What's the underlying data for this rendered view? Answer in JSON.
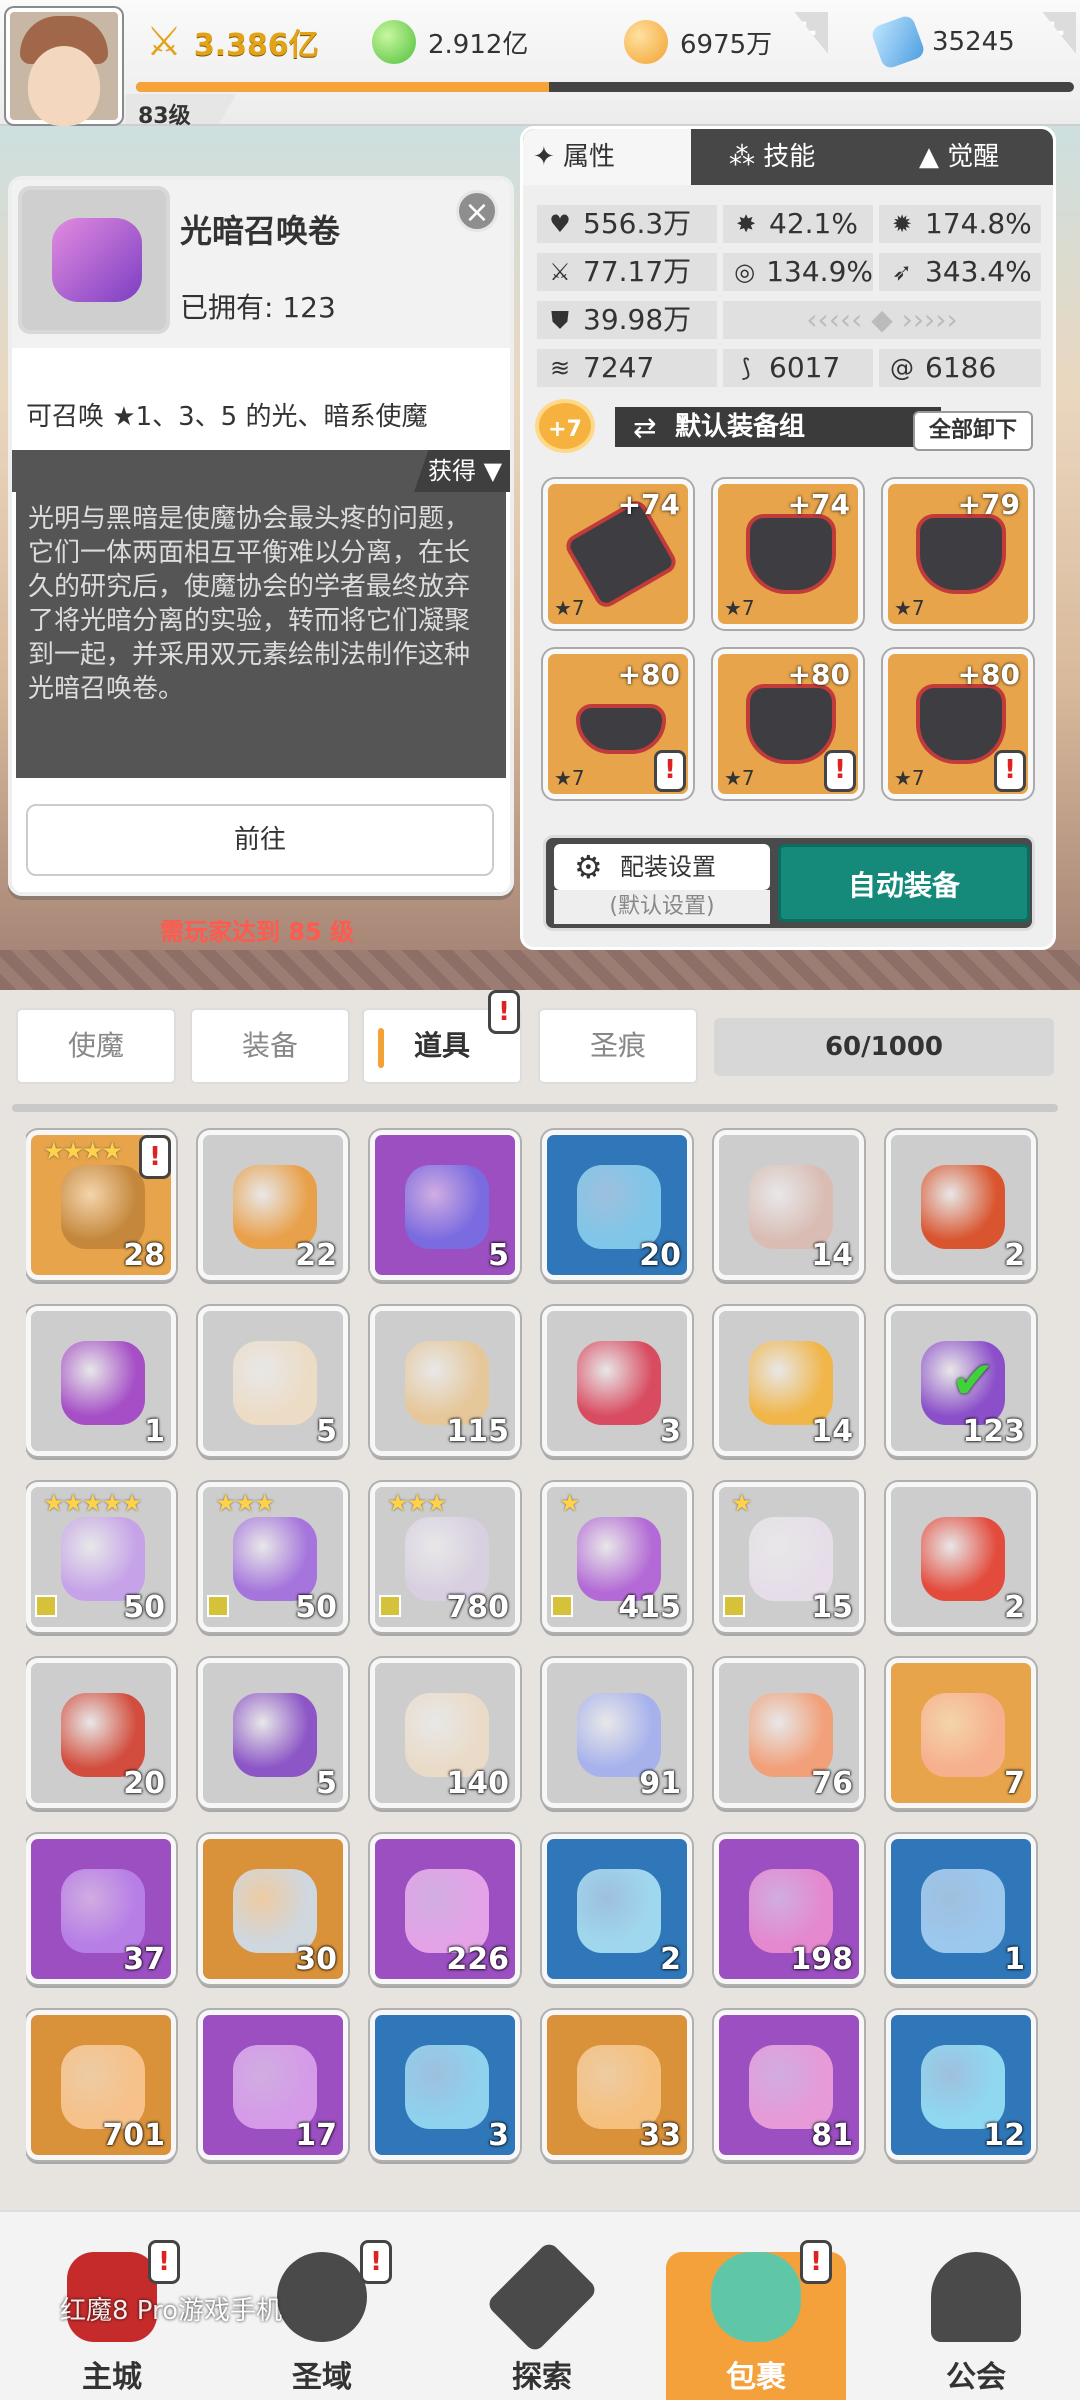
{
  "top_bar": {
    "level": "83级",
    "power": "3.386亿",
    "green_currency": "2.912亿",
    "gold_currency": "6975万",
    "gem_currency": "35245",
    "xp_progress": 0.44,
    "plus_symbol": "+"
  },
  "item_detail": {
    "name": "光暗召唤卷",
    "owned": "已拥有: 123",
    "summary": "可召唤 ★1、3、5 的光、暗系使魔",
    "obtain_label": "获得 ▼",
    "lore": "光明与黑暗是使魔协会最头疼的问题，它们一体两面相互平衡难以分离，在长久的研究后，使魔协会的学者最终放弃了将光暗分离的实验，转而将它们凝聚到一起，并采用双元素绘制法制作这种光暗召唤卷。",
    "go_button": "前往",
    "close": "×"
  },
  "requirement": "需玩家达到 85 级",
  "panel": {
    "tabs": [
      "属性",
      "技能",
      "觉醒"
    ],
    "stats": {
      "hp": "556.3万",
      "crit": "42.1%",
      "crit_dmg": "174.8%",
      "atk": "77.17万",
      "hit": "134.9%",
      "speed": "343.4%",
      "def": "39.98万",
      "v1": "7247",
      "v2": "6017",
      "v3": "6186"
    },
    "enhance_badge": "+7",
    "equip_group": "默认装备组",
    "unload_all": "全部卸下",
    "equipment": [
      {
        "level": "+74",
        "stars": "★7",
        "alert": false
      },
      {
        "level": "+74",
        "stars": "★7",
        "alert": false
      },
      {
        "level": "+79",
        "stars": "★7",
        "alert": false
      },
      {
        "level": "+80",
        "stars": "★7",
        "alert": true
      },
      {
        "level": "+80",
        "stars": "★7",
        "alert": true
      },
      {
        "level": "+80",
        "stars": "★7",
        "alert": true
      }
    ],
    "config_button": "配装设置",
    "config_sub": "(默认设置)",
    "auto_equip": "自动装备"
  },
  "categories": [
    "使魔",
    "装备",
    "道具",
    "圣痕"
  ],
  "capacity": "60/1000",
  "inventory": [
    {
      "count": "28",
      "bg": "#e7a44a",
      "art": "#c4873c",
      "stars": "★★★★",
      "alert": true
    },
    {
      "count": "22",
      "bg": "#cdcdcd",
      "art": "#e9a04a",
      "stars": ""
    },
    {
      "count": "5",
      "bg": "#9b4fc0",
      "art": "#7a6be0",
      "stars": ""
    },
    {
      "count": "20",
      "bg": "#2f77b8",
      "art": "#7fc6e8",
      "stars": ""
    },
    {
      "count": "14",
      "bg": "#cdcdcd",
      "art": "#d9bdb5",
      "stars": ""
    },
    {
      "count": "2",
      "bg": "#cdcdcd",
      "art": "#d9552f",
      "stars": ""
    },
    {
      "count": "1",
      "bg": "#cdcdcd",
      "art": "#a54ec6",
      "stars": ""
    },
    {
      "count": "5",
      "bg": "#cdcdcd",
      "art": "#ecdcc6",
      "stars": ""
    },
    {
      "count": "115",
      "bg": "#cdcdcd",
      "art": "#e6c79a",
      "stars": ""
    },
    {
      "count": "3",
      "bg": "#cdcdcd",
      "art": "#d94b60",
      "stars": ""
    },
    {
      "count": "14",
      "bg": "#cdcdcd",
      "art": "#f0b64a",
      "stars": ""
    },
    {
      "count": "123",
      "bg": "#cdcdcd",
      "art": "#8b4fc9",
      "stars": ""
    },
    {
      "count": "50",
      "bg": "#cdcdcd",
      "art": "#c6a3e8",
      "stars": "★★★★★"
    },
    {
      "count": "50",
      "bg": "#cdcdcd",
      "art": "#a574dc",
      "stars": "★★★"
    },
    {
      "count": "780",
      "bg": "#cdcdcd",
      "art": "#d8cfe0",
      "stars": "★★★"
    },
    {
      "count": "415",
      "bg": "#cdcdcd",
      "art": "#b46ad6",
      "stars": "★"
    },
    {
      "count": "15",
      "bg": "#cdcdcd",
      "art": "#e6dde8",
      "stars": "★"
    },
    {
      "count": "2",
      "bg": "#cdcdcd",
      "art": "#e34b3d",
      "stars": ""
    },
    {
      "count": "20",
      "bg": "#cdcdcd",
      "art": "#d24d3d",
      "stars": ""
    },
    {
      "count": "5",
      "bg": "#cdcdcd",
      "art": "#8c56c6",
      "stars": ""
    },
    {
      "count": "140",
      "bg": "#cdcdcd",
      "art": "#eadbc8",
      "stars": ""
    },
    {
      "count": "91",
      "bg": "#cdcdcd",
      "art": "#a7b2ec",
      "stars": ""
    },
    {
      "count": "76",
      "bg": "#cdcdcd",
      "art": "#f1a07a",
      "stars": ""
    },
    {
      "count": "7",
      "bg": "#e7a44a",
      "art": "#f6b08e",
      "stars": ""
    },
    {
      "count": "37",
      "bg": "#9b4fc0",
      "art": "#b77ee6",
      "stars": ""
    },
    {
      "count": "30",
      "bg": "#d9913a",
      "art": "#cfd7df",
      "stars": ""
    },
    {
      "count": "226",
      "bg": "#9b4fc0",
      "art": "#e3a3e6",
      "stars": ""
    },
    {
      "count": "2",
      "bg": "#2f77b8",
      "art": "#9fd8ee",
      "stars": ""
    },
    {
      "count": "198",
      "bg": "#9b4fc0",
      "art": "#e488d0",
      "stars": ""
    },
    {
      "count": "1",
      "bg": "#2f77b8",
      "art": "#9cc8ee",
      "stars": ""
    },
    {
      "count": "701",
      "bg": "#d9913a",
      "art": "#f6c18a",
      "stars": ""
    },
    {
      "count": "17",
      "bg": "#9b4fc0",
      "art": "#d59be8",
      "stars": ""
    },
    {
      "count": "3",
      "bg": "#2f77b8",
      "art": "#8ed2ee",
      "stars": ""
    },
    {
      "count": "33",
      "bg": "#d9913a",
      "art": "#f5c07e",
      "stars": ""
    },
    {
      "count": "81",
      "bg": "#9b4fc0",
      "art": "#e69ad8",
      "stars": ""
    },
    {
      "count": "12",
      "bg": "#2f77b8",
      "art": "#8fd8f0",
      "stars": ""
    }
  ],
  "nav": [
    "主城",
    "圣域",
    "探索",
    "包裹",
    "公会"
  ],
  "watermark": "红魔8 Pro游戏手机",
  "alert_mark": "!",
  "check_mark": "✔"
}
